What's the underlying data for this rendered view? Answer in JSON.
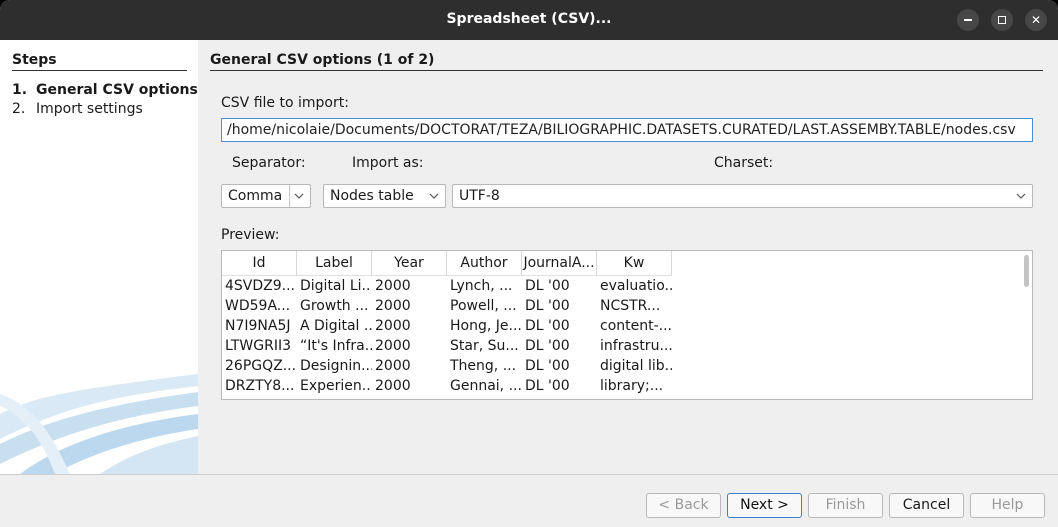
{
  "window": {
    "title": "Spreadsheet (CSV)..."
  },
  "sidebar": {
    "title": "Steps",
    "steps": [
      {
        "num": "1.",
        "label": "General CSV options",
        "active": true
      },
      {
        "num": "2.",
        "label": "Import settings",
        "active": false
      }
    ]
  },
  "main": {
    "section_title": "General CSV options (1 of 2)",
    "file_label": "CSV file to import:",
    "file_path": "/home/nicolaie/Documents/DOCTORAT/TEZA/BILIOGRAPHIC.DATASETS.CURATED/LAST.ASSEMBY.TABLE/nodes.csv",
    "separator_label": "Separator:",
    "separator_value": "Comma",
    "import_as_label": "Import as:",
    "import_as_value": "Nodes table",
    "charset_label": "Charset:",
    "charset_value": "UTF-8",
    "preview_label": "Preview:"
  },
  "table": {
    "columns": [
      "Id",
      "Label",
      "Year",
      "Author",
      "JournalA...",
      "Kw"
    ],
    "rows": [
      [
        "4SVDZ9...",
        "Digital Li...",
        "2000",
        "Lynch, ...",
        "DL '00",
        "evaluatio..."
      ],
      [
        "WD59A...",
        "Growth ...",
        "2000",
        "Powell, ...",
        "DL '00",
        "NCSTR..."
      ],
      [
        "N7I9NA5J",
        "A Digital ...",
        "2000",
        "Hong, Je...",
        "DL '00",
        "content-..."
      ],
      [
        "LTWGRII3",
        "“It's Infra...",
        "2000",
        "Star, Su...",
        "DL '00",
        "infrastru..."
      ],
      [
        "26PGQZ...",
        "Designin...",
        "2000",
        "Theng, ...",
        "DL '00",
        "digital lib..."
      ],
      [
        "DRZTY8...",
        "Experien...",
        "2000",
        "Gennai, ...",
        "DL '00",
        "library;..."
      ]
    ]
  },
  "buttons": {
    "back": "< Back",
    "next": "Next >",
    "finish": "Finish",
    "cancel": "Cancel",
    "help": "Help"
  },
  "colors": {
    "titlebar": "#2e2e2e",
    "focus_accent": "#4c8fd6",
    "dialog_bg": "#efefef"
  },
  "icons": {
    "minimize": "minimize-icon",
    "maximize": "maximize-icon",
    "close": "close-icon",
    "dropdown": "chevron-down-icon"
  }
}
